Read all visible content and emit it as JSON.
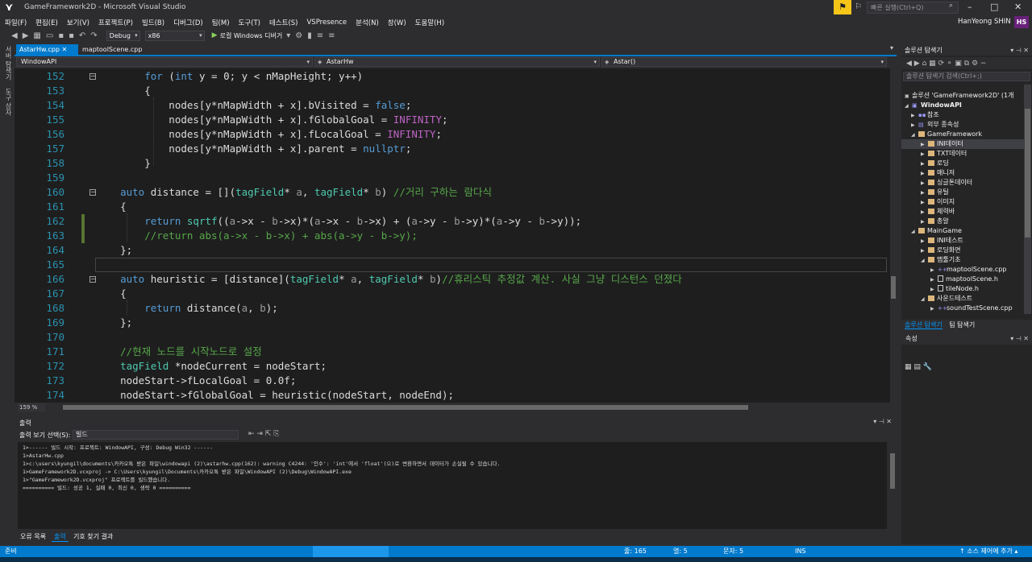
{
  "window": {
    "title": "GameFramework2D - Microsoft Visual Studio",
    "quick_launch": "빠른 실행(Ctrl+Q)",
    "user": "HanYeong SHIN",
    "avatar": "HS"
  },
  "menu": [
    "파일(F)",
    "편집(E)",
    "보기(V)",
    "프로젝트(P)",
    "빌드(B)",
    "디버그(D)",
    "팀(M)",
    "도구(T)",
    "테스트(S)",
    "VSPresence",
    "분석(N)",
    "창(W)",
    "도움말(H)"
  ],
  "toolbar": {
    "config": "Debug",
    "platform": "x86",
    "run_label": "로컬 Windows 디버거"
  },
  "left_strip": {
    "tab1": "서버 탐색기",
    "tab2": "도구 상자"
  },
  "tabs": [
    {
      "label": "AstarHw.cpp",
      "active": true
    },
    {
      "label": "maptoolScene.cpp",
      "active": false
    }
  ],
  "nav": {
    "project": "WindowAPI",
    "scope": "AstarHw",
    "member": "Astar()"
  },
  "editor": {
    "line_numbers": [
      "152",
      "153",
      "154",
      "155",
      "156",
      "157",
      "158",
      "159",
      "160",
      "161",
      "162",
      "163",
      "164",
      "165",
      "166",
      "167",
      "168",
      "169",
      "170",
      "171",
      "172",
      "173",
      "174"
    ],
    "zoom": "159 %"
  },
  "output": {
    "title": "출력",
    "show_label": "출력 보기 선택(S):",
    "source": "빌드",
    "lines": [
      "1>------ 빌드 시작: 프로젝트: WindowAPI, 구성: Debug Win32 ------",
      "1>AstarHw.cpp",
      "1>c:\\users\\kyungil\\documents\\카카오톡 받은 파일\\windowapi (2)\\astarhw.cpp(162): warning C4244: '인수': 'int'에서 'float'(으)로 변환하면서 데이터가 손실될 수 있습니다.",
      "1>GameFramework2D.vcxproj -> C:\\Users\\kyungil\\Documents\\카카오톡 받은 파일\\WindowAPI (2)\\Debug\\WindowAPI.exe",
      "1>\"GameFramework2D.vcxproj\" 프로젝트를 빌드했습니다.",
      "========== 빌드: 성공 1, 실패 0, 최신 0, 생략 0 =========="
    ]
  },
  "bottom_tabs": [
    "오류 목록",
    "출력",
    "기호 찾기 결과"
  ],
  "status": {
    "ready": "준비",
    "line": "줄: 165",
    "col": "열: 5",
    "ch": "문자: 5",
    "mode": "INS",
    "source_control": "소스 제어에 추가"
  },
  "solution": {
    "title": "솔루션 탐색기",
    "search": "솔루션 탐색기 검색(Ctrl+;)",
    "items": [
      "솔루션 'GameFramework2D' (1개",
      "WindowAPI",
      "참조",
      "외부 종속성",
      "GameFramework",
      "INI데이터",
      "TXT데이터",
      "로딩",
      "매니저",
      "싱글톤데이터",
      "유틸",
      "이미지",
      "체력바",
      "총알",
      "MainGame",
      "INI테스트",
      "로딩화면",
      "맵툴기초",
      "maptoolScene.cpp",
      "maptoolScene.h",
      "tileNode.h",
      "사운드테스트",
      "soundTestScene.cpp"
    ],
    "tab_active": "솔루션 탐색기",
    "tab_other": "팀 탐색기"
  },
  "properties": {
    "title": "속성"
  },
  "colors": {
    "accent": "#007acc",
    "background": "#2d2d30",
    "editor": "#1e1e1e",
    "keyword": "#569cd6",
    "type": "#4ec9b0",
    "comment": "#57a64a",
    "line_number": "#2b91af"
  }
}
